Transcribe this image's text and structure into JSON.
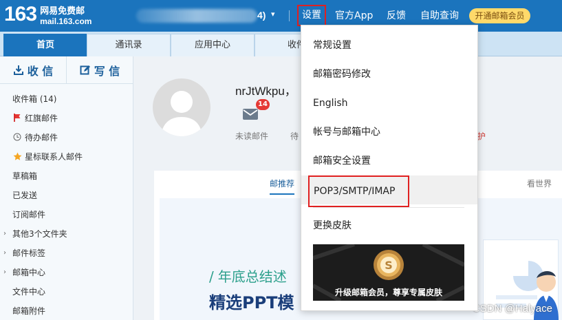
{
  "brand": {
    "number": "163",
    "name": "网易免费邮",
    "domain": "mail.163.com"
  },
  "account": {
    "suffix": "4)",
    "caret": "▾"
  },
  "topnav": {
    "settings": "设置",
    "official_app": "官方App",
    "feedback": "反馈",
    "self_service": "自助查询",
    "vip_button": "开通邮箱会员"
  },
  "tabs": [
    {
      "label": "首页",
      "active": true
    },
    {
      "label": "通讯录"
    },
    {
      "label": "应用中心"
    },
    {
      "label": "收件"
    }
  ],
  "sidebar": {
    "receive": "收 信",
    "compose": "写 信",
    "folders": [
      {
        "label": "收件箱 (14)"
      },
      {
        "label": "红旗邮件"
      },
      {
        "label": "待办邮件"
      },
      {
        "label": "星标联系人邮件"
      },
      {
        "label": "草稿箱"
      },
      {
        "label": "已发送"
      },
      {
        "label": "订阅邮件"
      },
      {
        "label": "其他3个文件夹"
      },
      {
        "label": "邮件标签"
      },
      {
        "label": "邮箱中心"
      },
      {
        "label": "文件中心"
      },
      {
        "label": "邮箱附件"
      }
    ]
  },
  "profile": {
    "username": "nrJtWkpu，",
    "unread_count": "14",
    "unread_label": "未读邮件",
    "todo_label_partial": "待",
    "protect_label_partial": "护"
  },
  "feed": {
    "tab_recommend": "邮推荐",
    "tab_world": "看世界",
    "banner_line1": "年底总结述",
    "banner_slash": "/",
    "banner_line2": "精选PPT模"
  },
  "dropdown": {
    "items": [
      "常规设置",
      "邮箱密码修改",
      "English",
      "帐号与邮箱中心",
      "邮箱安全设置",
      "POP3/SMTP/IMAP",
      "更换皮肤"
    ],
    "skin_banner_text": "升级邮箱会员，尊享专属皮肤"
  },
  "watermark": "CSDN @Halyace",
  "colors": {
    "primary": "#1b74bd",
    "highlight_box": "#e02020",
    "vip": "#ffd96a"
  }
}
